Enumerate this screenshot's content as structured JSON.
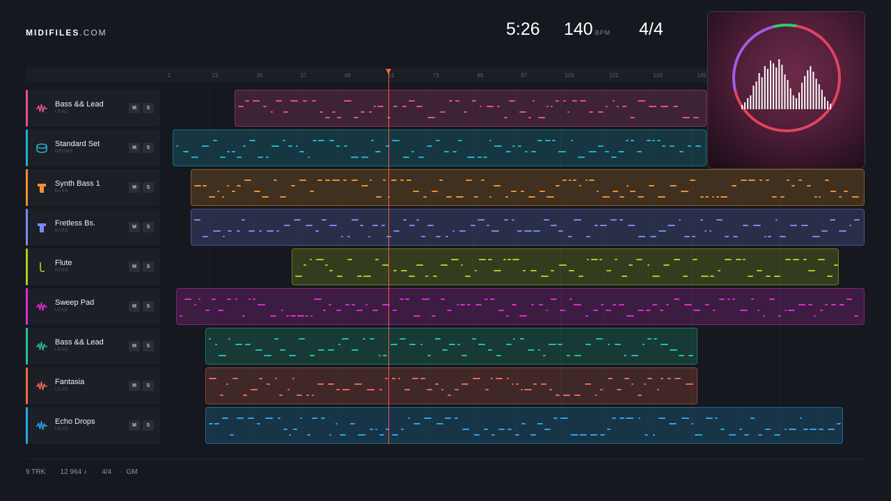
{
  "brand": {
    "name": "MIDIFILES",
    "domain": ".COM"
  },
  "transport": {
    "time": "5:26",
    "tempo": "140",
    "tempo_unit": "BPM",
    "signature": "4/4"
  },
  "ruler": {
    "ticks": [
      "1",
      "13",
      "25",
      "37",
      "49",
      "61",
      "73",
      "85",
      "97",
      "109",
      "121",
      "133",
      "145"
    ]
  },
  "tracks": [
    {
      "name": "Bass && Lead",
      "category": "LEAD",
      "color": "#e8508a",
      "icon": "waveform-icon"
    },
    {
      "name": "Standard Set",
      "category": "DRUMS",
      "color": "#1fb5cf",
      "icon": "drum-icon"
    },
    {
      "name": "Synth Bass 1",
      "category": "BASS",
      "color": "#f2912a",
      "icon": "bass-icon"
    },
    {
      "name": "Fretless Bs.",
      "category": "BASS",
      "color": "#7b8af0",
      "icon": "bass-icon"
    },
    {
      "name": "Flute",
      "category": "REED",
      "color": "#b2cc1c",
      "icon": "flute-icon"
    },
    {
      "name": "Sweep Pad",
      "category": "LEAD",
      "color": "#e02bd2",
      "icon": "waveform-icon"
    },
    {
      "name": "Bass && Lead",
      "category": "LEAD",
      "color": "#24c49a",
      "icon": "waveform-icon"
    },
    {
      "name": "Fantasia",
      "category": "LEAD",
      "color": "#f26a4e",
      "icon": "waveform-icon"
    },
    {
      "name": "Echo Drops",
      "category": "LEAD",
      "color": "#2aa7ec",
      "icon": "waveform-icon"
    }
  ],
  "buttons": {
    "mute": "M",
    "solo": "S"
  },
  "footer": {
    "tracks": "9 TRK",
    "notes": "12 964 ♪",
    "signature": "4/4",
    "standard": "GM"
  },
  "visualizer": {
    "ring_colors": [
      "#e0455c",
      "#a05ee0",
      "#2ecc71"
    ],
    "bar_color": "#ffffff"
  }
}
